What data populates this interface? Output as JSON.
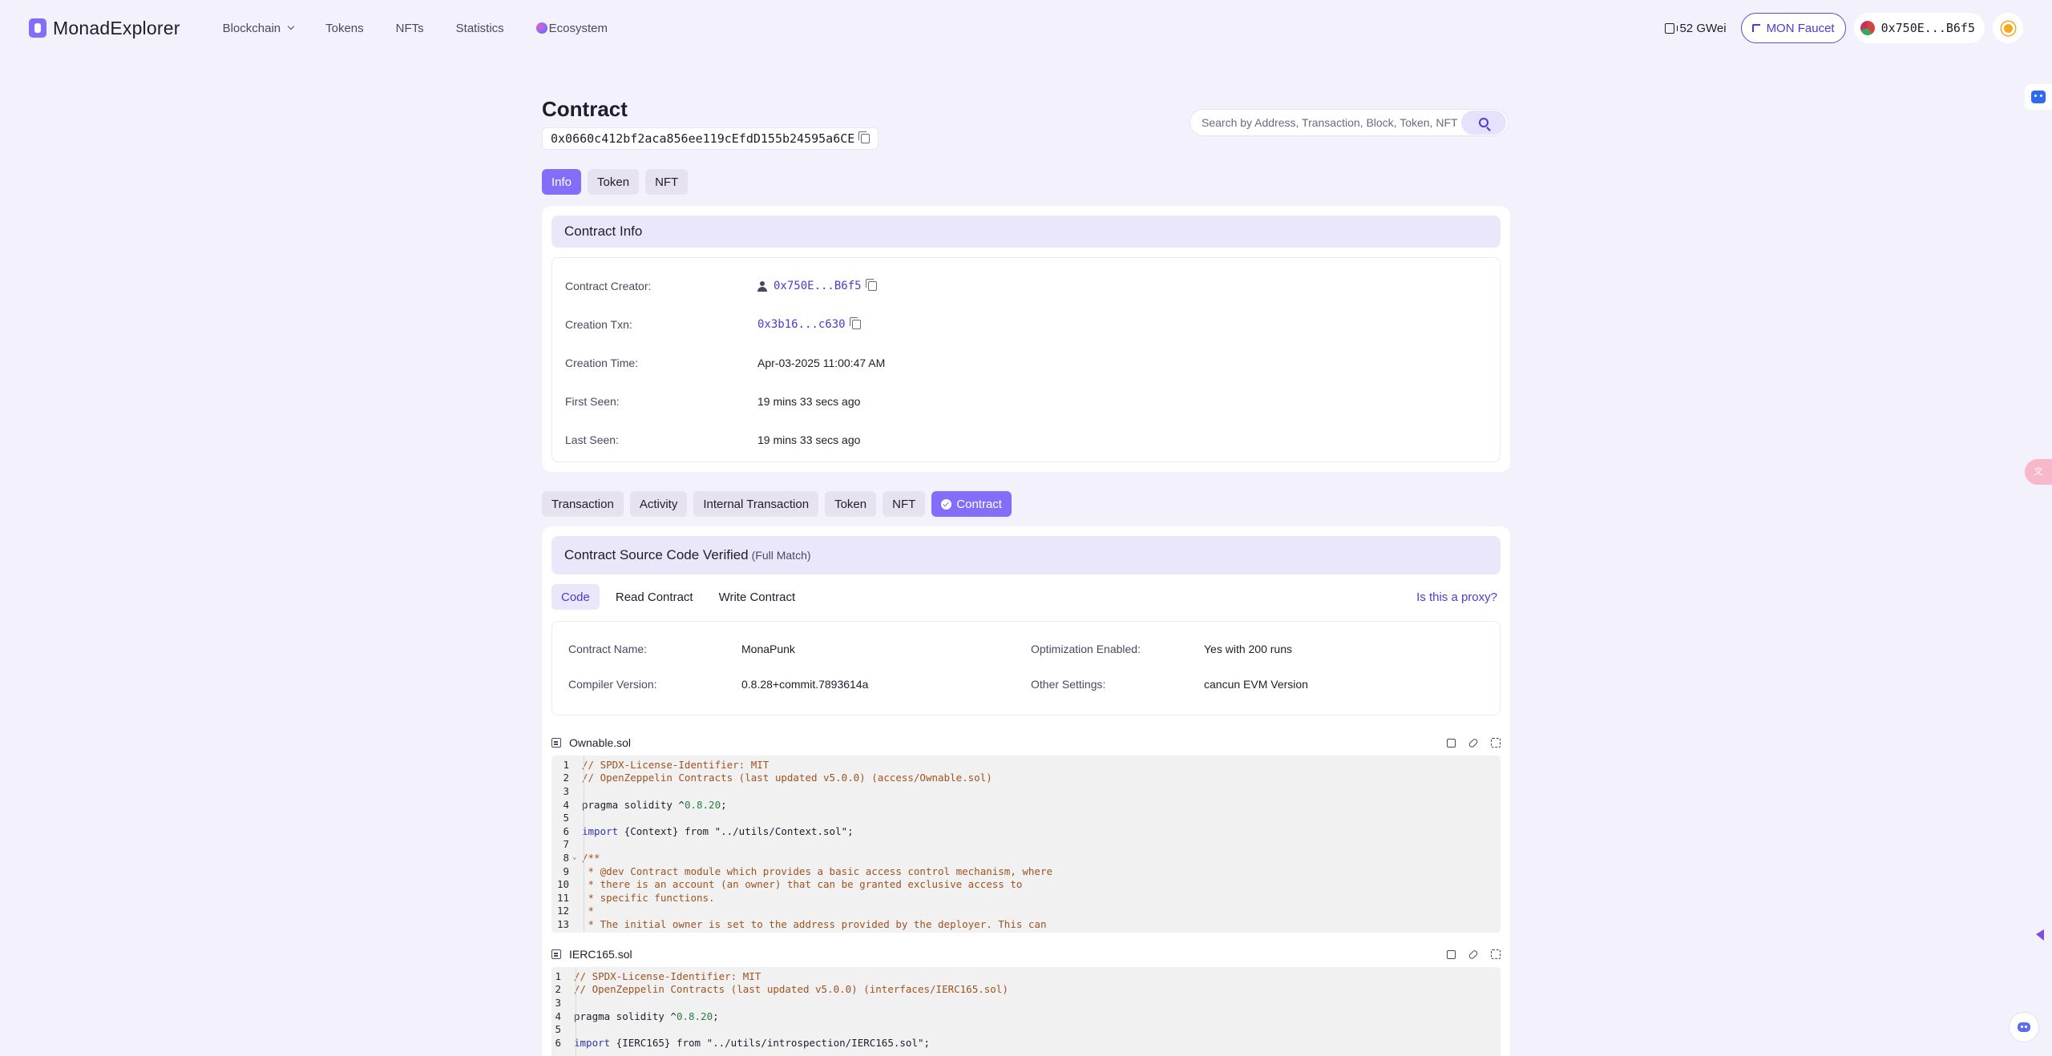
{
  "nav": {
    "brand": "MonadExplorer",
    "links": [
      {
        "label": "Blockchain",
        "dropdown": true
      },
      {
        "label": "Tokens"
      },
      {
        "label": "NFTs"
      },
      {
        "label": "Statistics"
      },
      {
        "label": "Ecosystem",
        "icon": "ecosystem-icon"
      }
    ],
    "gas": "52 GWei",
    "faucet": "MON Faucet",
    "wallet": "0x750E...B6f5"
  },
  "header": {
    "title": "Contract",
    "address": "0x0660c412bf2aca856ee119cEfdD155b24595a6CE",
    "search_placeholder": "Search by Address, Transaction, Block, Token, NFT"
  },
  "top_tabs": [
    {
      "label": "Info",
      "active": true
    },
    {
      "label": "Token"
    },
    {
      "label": "NFT"
    }
  ],
  "contract_info": {
    "title": "Contract Info",
    "rows": [
      {
        "label": "Contract Creator:",
        "value": "0x750E...B6f5",
        "type": "link-user-copy"
      },
      {
        "label": "Creation Txn:",
        "value": "0x3b16...c630",
        "type": "link-copy"
      },
      {
        "label": "Creation Time:",
        "value": "Apr-03-2025 11:00:47 AM"
      },
      {
        "label": "First Seen:",
        "value": "19 mins 33 secs ago"
      },
      {
        "label": "Last Seen:",
        "value": "19 mins 33 secs ago"
      }
    ]
  },
  "section_tabs": [
    {
      "label": "Transaction"
    },
    {
      "label": "Activity"
    },
    {
      "label": "Internal Transaction"
    },
    {
      "label": "Token"
    },
    {
      "label": "NFT"
    },
    {
      "label": "Contract",
      "active": true
    }
  ],
  "source": {
    "title": "Contract Source Code Verified",
    "subtitle": "(Full Match)",
    "subtabs": [
      {
        "label": "Code",
        "active": true
      },
      {
        "label": "Read Contract"
      },
      {
        "label": "Write Contract"
      }
    ],
    "proxy_link": "Is this a proxy?",
    "meta": {
      "contract_name_label": "Contract Name:",
      "contract_name": "MonaPunk",
      "compiler_label": "Compiler Version:",
      "compiler": "0.8.28+commit.7893614a",
      "optimization_label": "Optimization Enabled:",
      "optimization": "Yes with 200 runs",
      "settings_label": "Other Settings:",
      "settings": "cancun EVM Version"
    },
    "files": [
      {
        "name": "Ownable.sol",
        "lines": [
          [
            [
              "c",
              "// SPDX-License-Identifier: MIT"
            ]
          ],
          [
            [
              "c",
              "// OpenZeppelin Contracts (last updated v5.0.0) (access/Ownable.sol)"
            ]
          ],
          [],
          [
            [
              "p",
              "pragma solidity ^"
            ],
            [
              "n",
              "0.8.20"
            ],
            [
              "p",
              ";"
            ]
          ],
          [],
          [
            [
              "k",
              "import"
            ],
            [
              "p",
              " {Context} from \"../utils/Context.sol\";"
            ]
          ],
          [],
          [
            [
              "c",
              "/**"
            ]
          ],
          [
            [
              "c",
              " * @dev Contract module which provides a basic access control mechanism, where"
            ]
          ],
          [
            [
              "c",
              " * there is an account (an owner) that can be granted exclusive access to"
            ]
          ],
          [
            [
              "c",
              " * specific functions."
            ]
          ],
          [
            [
              "c",
              " *"
            ]
          ],
          [
            [
              "c",
              " * The initial owner is set to the address provided by the deployer. This can"
            ]
          ]
        ]
      },
      {
        "name": "IERC165.sol",
        "lines": [
          [
            [
              "c",
              "// SPDX-License-Identifier: MIT"
            ]
          ],
          [
            [
              "c",
              "// OpenZeppelin Contracts (last updated v5.0.0) (interfaces/IERC165.sol)"
            ]
          ],
          [],
          [
            [
              "p",
              "pragma solidity ^"
            ],
            [
              "n",
              "0.8.20"
            ],
            [
              "p",
              ";"
            ]
          ],
          [],
          [
            [
              "k",
              "import"
            ],
            [
              "p",
              " {IERC165} from \"../utils/introspection/IERC165.sol\";"
            ]
          ]
        ]
      }
    ]
  },
  "icons": {
    "brand": "monad-logo-icon",
    "gas": "gas-pump-icon",
    "faucet": "faucet-icon",
    "theme": "sun-icon",
    "search": "search-icon",
    "copy": "copy-icon",
    "floating": [
      "robot-icon",
      "translate-icon",
      "bird-icon",
      "discord-icon"
    ]
  },
  "colors": {
    "accent": "#836ef9",
    "link": "#4a3bd3",
    "background": "#f3f1fb",
    "card_header": "#ebe7fb"
  }
}
